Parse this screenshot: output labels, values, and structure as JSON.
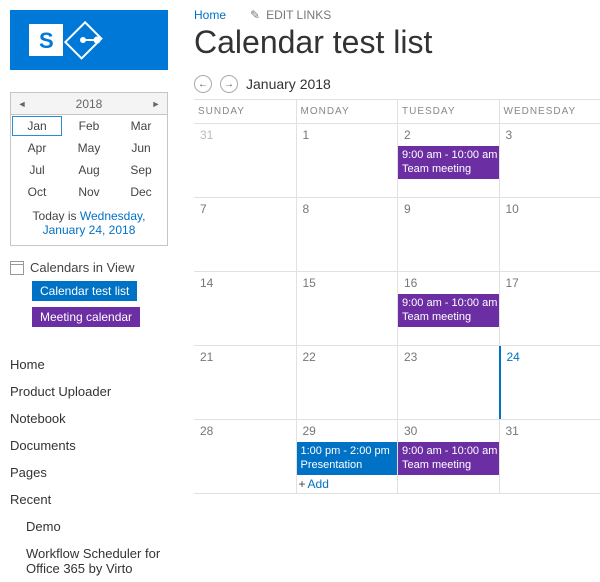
{
  "header": {
    "home": "Home",
    "edit_links": "EDIT LINKS",
    "title": "Calendar test list"
  },
  "datepicker": {
    "year": "2018",
    "months": [
      "Jan",
      "Feb",
      "Mar",
      "Apr",
      "May",
      "Jun",
      "Jul",
      "Aug",
      "Sep",
      "Oct",
      "Nov",
      "Dec"
    ],
    "selected": "Jan",
    "today_prefix": "Today is ",
    "today_date": "Wednesday, January 24, 2018"
  },
  "calendars_in_view": {
    "title": "Calendars in View",
    "items": [
      {
        "label": "Calendar test list",
        "color": "blue"
      },
      {
        "label": "Meeting calendar",
        "color": "purple"
      }
    ]
  },
  "nav": {
    "items": [
      "Home",
      "Product Uploader",
      "Notebook",
      "Documents",
      "Pages",
      "Recent"
    ],
    "recent_children": [
      "Demo",
      "Workflow Scheduler for Office 365 by Virto"
    ]
  },
  "month_nav": {
    "label": "January 2018"
  },
  "calendar": {
    "day_headers": [
      "SUNDAY",
      "MONDAY",
      "TUESDAY",
      "WEDNESDAY"
    ],
    "weeks": [
      {
        "days": [
          {
            "num": "31",
            "other": true
          },
          {
            "num": "1"
          },
          {
            "num": "2",
            "events": [
              {
                "time": "9:00 am - 10:00 am",
                "title": "Team meeting",
                "color": "purple"
              }
            ]
          },
          {
            "num": "3"
          }
        ]
      },
      {
        "days": [
          {
            "num": "7"
          },
          {
            "num": "8"
          },
          {
            "num": "9"
          },
          {
            "num": "10"
          }
        ]
      },
      {
        "days": [
          {
            "num": "14"
          },
          {
            "num": "15"
          },
          {
            "num": "16",
            "events": [
              {
                "time": "9:00 am - 10:00 am",
                "title": "Team meeting",
                "color": "purple"
              }
            ]
          },
          {
            "num": "17"
          }
        ]
      },
      {
        "days": [
          {
            "num": "21"
          },
          {
            "num": "22"
          },
          {
            "num": "23"
          },
          {
            "num": "24",
            "today": true
          }
        ]
      },
      {
        "days": [
          {
            "num": "28"
          },
          {
            "num": "29",
            "add": true,
            "events": [
              {
                "time": "1:00 pm - 2:00 pm",
                "title": "Presentation",
                "color": "blue"
              }
            ]
          },
          {
            "num": "30",
            "events": [
              {
                "time": "9:00 am - 10:00 am",
                "title": "Team meeting",
                "color": "purple"
              }
            ]
          },
          {
            "num": "31"
          }
        ]
      }
    ],
    "add_label": "Add"
  }
}
